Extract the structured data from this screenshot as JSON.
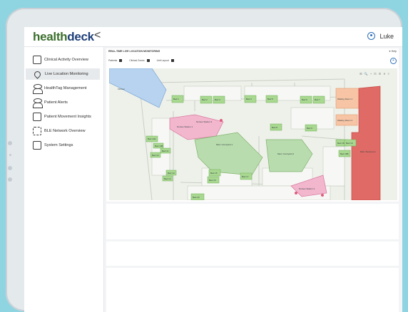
{
  "app": {
    "logo_a": "health",
    "logo_b": "deck",
    "collapse_label": "<"
  },
  "user": {
    "name": "Luke"
  },
  "sidebar": {
    "items": [
      {
        "label": "Clinical Activity Overview"
      },
      {
        "label": "Live Location Monitoring"
      },
      {
        "label": "HealthTag Management"
      },
      {
        "label": "Patient Alerts"
      },
      {
        "label": "Patient Movement Insights"
      },
      {
        "label": "BLE Network Overview"
      },
      {
        "label": "System Settings"
      }
    ]
  },
  "panel": {
    "title": "REAL-TIME LIVE LOCATION MONITORING",
    "help": "Help",
    "fit": "+",
    "filters": [
      {
        "label": "Patients"
      },
      {
        "label": "Clinical Zones"
      },
      {
        "label": "Unit Layout"
      }
    ],
    "tools": "⊞ 🔍 + ⊡ ⊟ ✕ ≡"
  },
  "map": {
    "zones": [
      {
        "label": "Bed 1"
      },
      {
        "label": "Bed 2"
      },
      {
        "label": "Bed 3"
      },
      {
        "label": "Bed 4"
      },
      {
        "label": "Bed 5"
      },
      {
        "label": "Bed 6"
      },
      {
        "label": "Bed 7"
      },
      {
        "label": "Bed 8"
      },
      {
        "label": "Bed 9"
      },
      {
        "label": "Bed 10A"
      },
      {
        "label": "Bed 10B"
      },
      {
        "label": "Bed 11"
      },
      {
        "label": "Bed 12"
      },
      {
        "label": "Bed 13"
      },
      {
        "label": "Bed 14"
      },
      {
        "label": "Bed 15"
      },
      {
        "label": "Bed 16"
      },
      {
        "label": "Bed 17"
      },
      {
        "label": "Bed 18"
      },
      {
        "label": "Bed 19"
      },
      {
        "label": "Bed 19B"
      },
      {
        "label": "Bed 20"
      },
      {
        "label": "Med. Courtyard 1"
      },
      {
        "label": "Med. Courtyard 2"
      },
      {
        "label": "Nurses Station 1"
      },
      {
        "label": "Nurses Station 2"
      },
      {
        "label": "Nurses Station 3"
      },
      {
        "label": "Waiting Room 1"
      },
      {
        "label": "Waiting Room 2"
      },
      {
        "label": "Med. Storeroom"
      },
      {
        "label": "Kitchen"
      }
    ]
  },
  "colors": {
    "accent": "#2c6fb7",
    "logo_green": "#3b6f2c",
    "logo_blue": "#1e3f79"
  }
}
